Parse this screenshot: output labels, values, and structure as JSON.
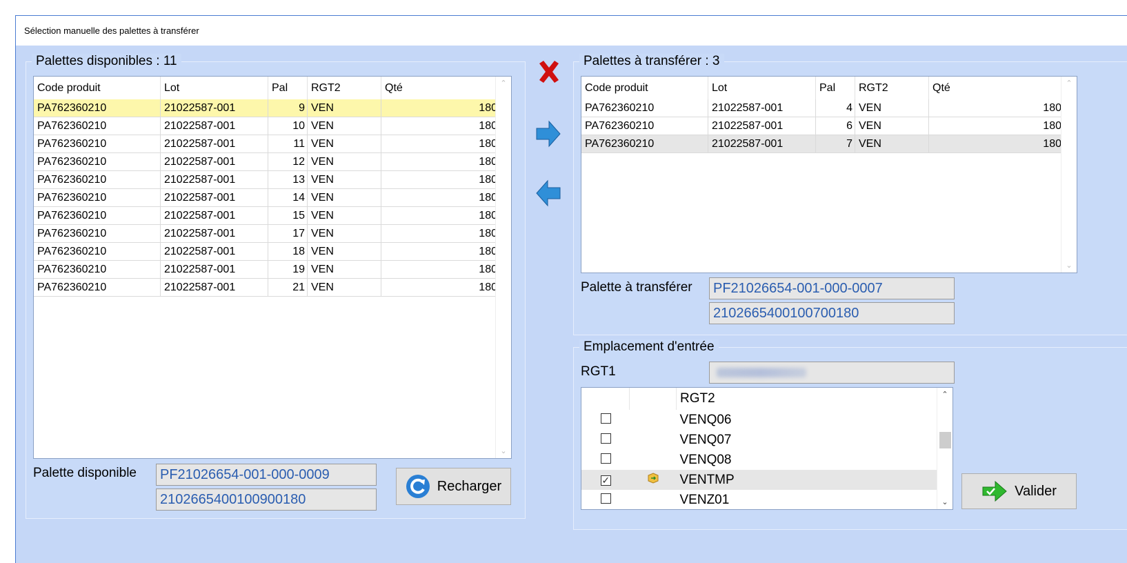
{
  "window": {
    "title": "Sélection manuelle des palettes à transférer"
  },
  "available": {
    "title": "Palettes disponibles : 11",
    "columns": [
      "Code produit",
      "Lot",
      "Pal",
      "RGT2",
      "Qté"
    ],
    "rows": [
      [
        "PA762360210",
        "21022587-001",
        "9",
        "VEN",
        "180"
      ],
      [
        "PA762360210",
        "21022587-001",
        "10",
        "VEN",
        "180"
      ],
      [
        "PA762360210",
        "21022587-001",
        "11",
        "VEN",
        "180"
      ],
      [
        "PA762360210",
        "21022587-001",
        "12",
        "VEN",
        "180"
      ],
      [
        "PA762360210",
        "21022587-001",
        "13",
        "VEN",
        "180"
      ],
      [
        "PA762360210",
        "21022587-001",
        "14",
        "VEN",
        "180"
      ],
      [
        "PA762360210",
        "21022587-001",
        "15",
        "VEN",
        "180"
      ],
      [
        "PA762360210",
        "21022587-001",
        "17",
        "VEN",
        "180"
      ],
      [
        "PA762360210",
        "21022587-001",
        "18",
        "VEN",
        "180"
      ],
      [
        "PA762360210",
        "21022587-001",
        "19",
        "VEN",
        "180"
      ],
      [
        "PA762360210",
        "21022587-001",
        "21",
        "VEN",
        "180"
      ]
    ],
    "selected_index": 0,
    "palette_label": "Palette disponible",
    "palette_code": "PF21026654-001-000-0009",
    "palette_barcode": "2102665400100900180",
    "reload_label": "Recharger"
  },
  "transfer": {
    "title": "Palettes à transférer : 3",
    "columns": [
      "Code produit",
      "Lot",
      "Pal",
      "RGT2",
      "Qté"
    ],
    "rows": [
      [
        "PA762360210",
        "21022587-001",
        "4",
        "VEN",
        "180"
      ],
      [
        "PA762360210",
        "21022587-001",
        "6",
        "VEN",
        "180"
      ],
      [
        "PA762360210",
        "21022587-001",
        "7",
        "VEN",
        "180"
      ]
    ],
    "selected_index": 2,
    "palette_label": "Palette à transférer",
    "palette_code": "PF21026654-001-000-0007",
    "palette_barcode": "2102665400100700180"
  },
  "location": {
    "title": "Emplacement d'entrée",
    "rgt1_label": "RGT1",
    "rgt1_value": "",
    "rgt2_header": "RGT2",
    "items": [
      {
        "name": "VENQ06",
        "checked": false,
        "icon": ""
      },
      {
        "name": "VENQ07",
        "checked": false,
        "icon": ""
      },
      {
        "name": "VENQ08",
        "checked": false,
        "icon": ""
      },
      {
        "name": "VENTMP",
        "checked": true,
        "icon": "box-arrow-icon"
      },
      {
        "name": "VENZ01",
        "checked": false,
        "icon": ""
      }
    ],
    "validate_label": "Valider"
  },
  "colors": {
    "background": "#c5d7f7",
    "field_text": "#2a5db0",
    "selected_row": "#fdf7ab",
    "delete_red": "#d01010",
    "arrow_blue": "#2f8fd8",
    "validate_green": "#2fb82f"
  }
}
